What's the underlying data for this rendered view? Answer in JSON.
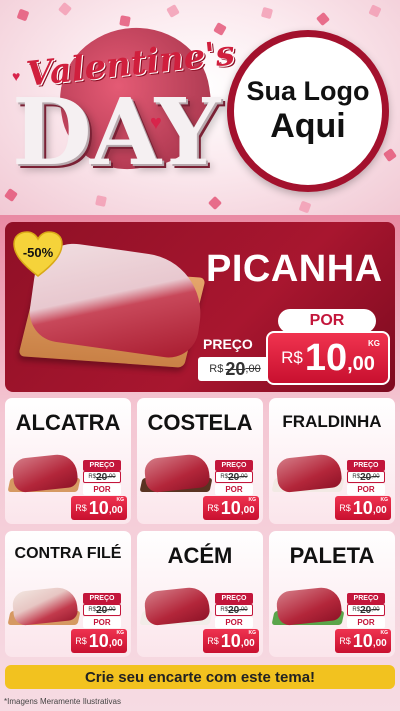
{
  "header": {
    "title_script": "Valentine's",
    "title_main": "DAY",
    "logo_line1": "Sua Logo",
    "logo_line2": "Aqui"
  },
  "hero": {
    "product": "PICANHA",
    "discount_badge": "-50%",
    "preco_label": "PREÇO",
    "old_currency": "R$",
    "old_price_int": "20",
    "old_price_dec": ",00",
    "por_label": "POR",
    "new_currency": "R$",
    "new_price_int": "10",
    "new_price_dec": ",00",
    "unit": "KG"
  },
  "products": [
    {
      "name": "ALCATRA",
      "preco": "PREÇO",
      "old_cur": "R$",
      "old_int": "20",
      "old_dec": ",00",
      "por": "POR",
      "cur": "R$",
      "int": "10",
      "dec": ",00",
      "unit": "KG"
    },
    {
      "name": "COSTELA",
      "preco": "PREÇO",
      "old_cur": "R$",
      "old_int": "20",
      "old_dec": ",00",
      "por": "POR",
      "cur": "R$",
      "int": "10",
      "dec": ",00",
      "unit": "KG"
    },
    {
      "name": "FRALDINHA",
      "preco": "PREÇO",
      "old_cur": "R$",
      "old_int": "20",
      "old_dec": ",00",
      "por": "POR",
      "cur": "R$",
      "int": "10",
      "dec": ",00",
      "unit": "KG"
    },
    {
      "name": "CONTRA FILÉ",
      "preco": "PREÇO",
      "old_cur": "R$",
      "old_int": "20",
      "old_dec": ",00",
      "por": "POR",
      "cur": "R$",
      "int": "10",
      "dec": ",00",
      "unit": "KG"
    },
    {
      "name": "ACÉM",
      "preco": "PREÇO",
      "old_cur": "R$",
      "old_int": "20",
      "old_dec": ",00",
      "por": "POR",
      "cur": "R$",
      "int": "10",
      "dec": ",00",
      "unit": "KG"
    },
    {
      "name": "PALETA",
      "preco": "PREÇO",
      "old_cur": "R$",
      "old_int": "20",
      "old_dec": ",00",
      "por": "POR",
      "cur": "R$",
      "int": "10",
      "dec": ",00",
      "unit": "KG"
    }
  ],
  "footer": {
    "cta": "Crie seu encarte com este tema!",
    "disclaimer": "*Imagens Meramente Ilustrativas"
  },
  "colors": {
    "brand_red": "#a8162f",
    "price_red": "#c8102f",
    "cta_yellow": "#f2c21f",
    "badge_yellow": "#f5d33a"
  }
}
